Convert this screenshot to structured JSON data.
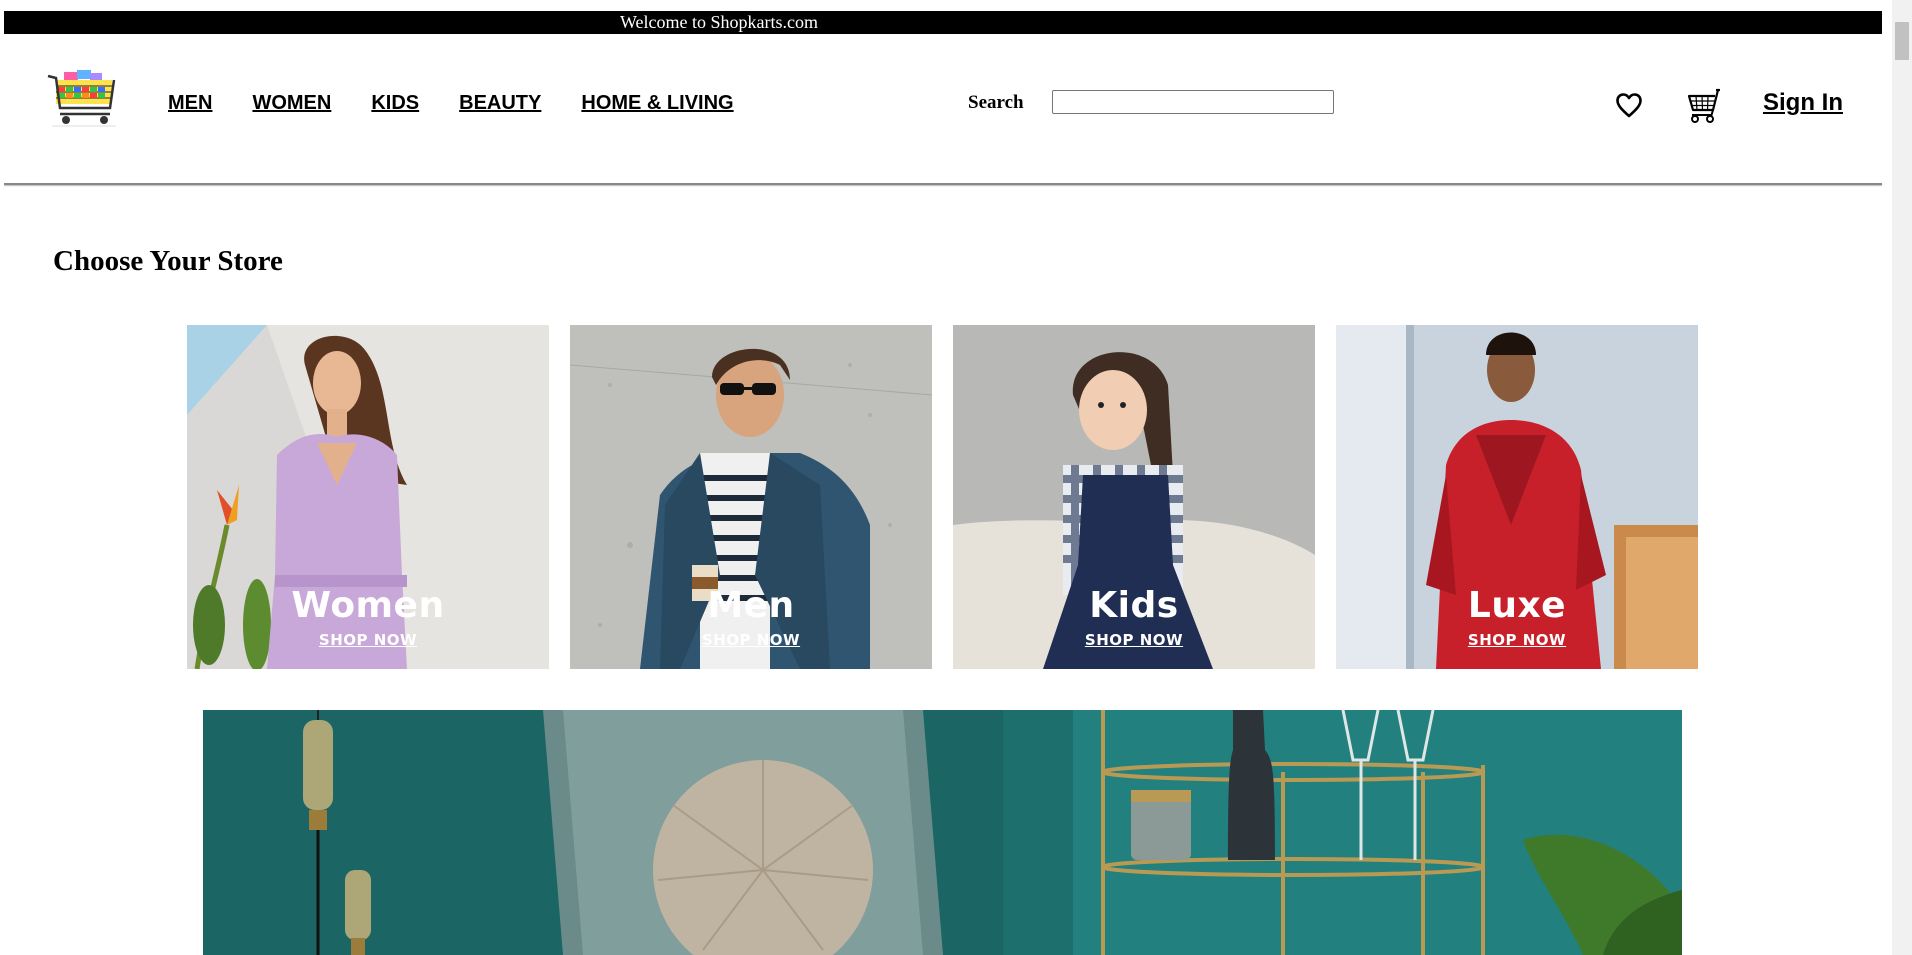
{
  "welcome_bar": {
    "text": "Welcome to Shopkarts.com"
  },
  "header": {
    "logo_icon": "shopping-cart-logo",
    "nav": [
      {
        "label": "MEN"
      },
      {
        "label": "WOMEN"
      },
      {
        "label": "KIDS"
      },
      {
        "label": "BEAUTY"
      },
      {
        "label": "HOME & LIVING"
      }
    ],
    "search": {
      "label": "Search",
      "value": "",
      "placeholder": ""
    },
    "wishlist_icon": "heart-icon",
    "cart_icon": "cart-icon",
    "signin_label": "Sign In"
  },
  "main": {
    "section_title": "Choose Your Store",
    "stores": [
      {
        "title": "Women",
        "cta": "SHOP NOW"
      },
      {
        "title": "Men",
        "cta": "SHOP NOW"
      },
      {
        "title": "Kids",
        "cta": "SHOP NOW"
      },
      {
        "title": "Luxe",
        "cta": "SHOP NOW"
      }
    ],
    "banner": {
      "name": "home-living-banner"
    }
  },
  "colors": {
    "welcome_bg": "#000000",
    "banner_teal": "#1d6e6d"
  }
}
